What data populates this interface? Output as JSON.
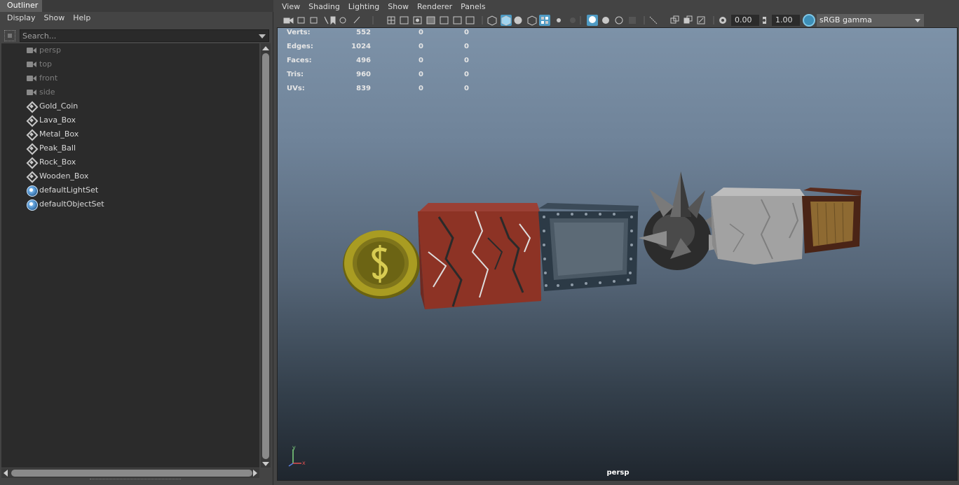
{
  "outliner": {
    "tab_label": "Outliner",
    "menus": [
      "Display",
      "Show",
      "Help"
    ],
    "search_placeholder": "Search...",
    "items": [
      {
        "label": "persp",
        "kind": "camera",
        "icon": "camera-icon"
      },
      {
        "label": "top",
        "kind": "camera",
        "icon": "camera-icon"
      },
      {
        "label": "front",
        "kind": "camera",
        "icon": "camera-icon"
      },
      {
        "label": "side",
        "kind": "camera",
        "icon": "camera-icon"
      },
      {
        "label": "Gold_Coin",
        "kind": "mesh",
        "icon": "mesh-icon"
      },
      {
        "label": "Lava_Box",
        "kind": "mesh",
        "icon": "mesh-icon"
      },
      {
        "label": "Metal_Box",
        "kind": "mesh",
        "icon": "mesh-icon"
      },
      {
        "label": "Peak_Ball",
        "kind": "mesh",
        "icon": "mesh-icon"
      },
      {
        "label": "Rock_Box",
        "kind": "mesh",
        "icon": "mesh-icon"
      },
      {
        "label": "Wooden_Box",
        "kind": "mesh",
        "icon": "mesh-icon"
      },
      {
        "label": "defaultLightSet",
        "kind": "set",
        "icon": "set-icon"
      },
      {
        "label": "defaultObjectSet",
        "kind": "set",
        "icon": "set-icon"
      }
    ]
  },
  "viewport": {
    "menus": [
      "View",
      "Shading",
      "Lighting",
      "Show",
      "Renderer",
      "Panels"
    ],
    "exposure": "0.00",
    "gamma": "1.00",
    "color_space": "sRGB gamma",
    "camera_label": "persp",
    "hud": [
      {
        "key": "Verts:",
        "v1": "552",
        "v2": "0",
        "v3": "0"
      },
      {
        "key": "Edges:",
        "v1": "1024",
        "v2": "0",
        "v3": "0"
      },
      {
        "key": "Faces:",
        "v1": "496",
        "v2": "0",
        "v3": "0"
      },
      {
        "key": "Tris:",
        "v1": "960",
        "v2": "0",
        "v3": "0"
      },
      {
        "key": "UVs:",
        "v1": "839",
        "v2": "0",
        "v3": "0"
      }
    ],
    "axis": {
      "y": "y",
      "x": "x"
    }
  },
  "colors": {
    "accent": "#4f9bc4",
    "panel_bg": "#444444",
    "tree_bg": "#2b2b2b"
  }
}
